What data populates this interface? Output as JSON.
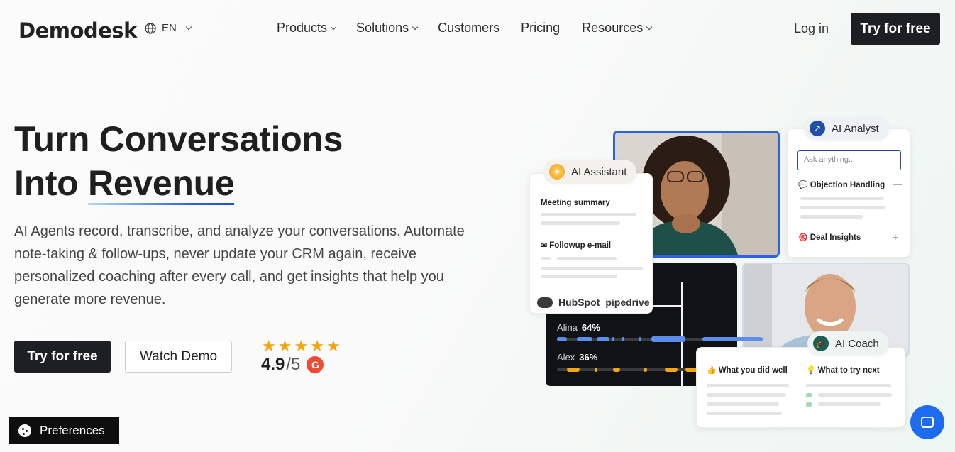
{
  "nav": {
    "logo": "Demodesk",
    "language": "EN",
    "menu": [
      "Products",
      "Solutions",
      "Customers",
      "Pricing",
      "Resources"
    ],
    "login": "Log in",
    "cta": "Try for free"
  },
  "hero": {
    "title_line1": "Turn Conversations",
    "title_line2_prefix": "Into ",
    "title_line2_highlight": "Revenue",
    "subtitle": "AI Agents record, transcribe, and analyze your conversations. Automate note-taking & follow-ups, never update your CRM again, receive personalized coaching after every call, and get insights that help you generate more revenue.",
    "primary_cta": "Try for free",
    "secondary_cta": "Watch Demo",
    "rating_score": "4.9",
    "rating_of": "/5",
    "rating_stars": 5
  },
  "visual": {
    "assistant_label": "AI Assistant",
    "assistant_item1": "Meeting summary",
    "assistant_item2": "Followup e-mail",
    "crm_logo1": "HubSpot",
    "crm_logo2": "pipedrive",
    "analyst_label": "AI Analyst",
    "analyst_placeholder": "Ask anything...",
    "analyst_item1": "Objection Handling",
    "analyst_item2": "Deal Insights",
    "speaker1_name": "Alina",
    "speaker1_pct": "64%",
    "speaker2_name": "Alex",
    "speaker2_pct": "36%",
    "coach_label": "AI Coach",
    "coach_col1": "What you did well",
    "coach_col2": "What to try next"
  },
  "preferences": "Preferences",
  "colors": {
    "dark_button": "#1e1f22",
    "accent_blue": "#2c63e6",
    "star": "#f5a30a",
    "g2": "#ef4b33",
    "chat": "#1c6bf0",
    "alina_track": "#5b8def",
    "alex_track": "#f6a609"
  }
}
